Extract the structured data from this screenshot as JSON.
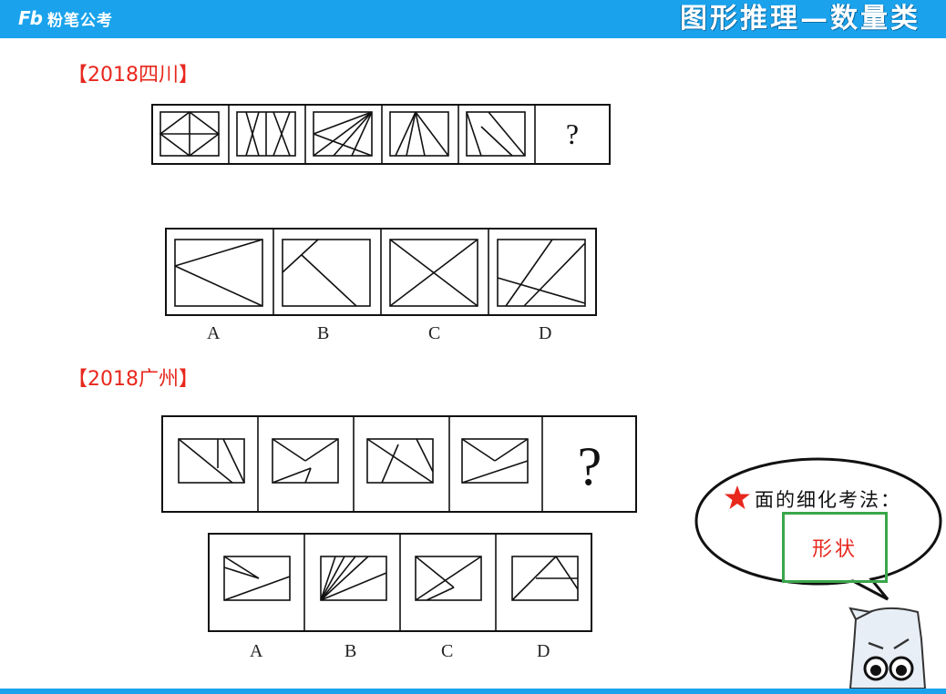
{
  "header": {
    "logo_mark": "Fb",
    "logo_text": "粉笔公考",
    "title": "图形推理—数量类"
  },
  "question1": {
    "label": "【2018四川】",
    "question_mark": "?",
    "options": [
      "A",
      "B",
      "C",
      "D"
    ]
  },
  "question2": {
    "label": "【2018广州】",
    "question_mark": "?",
    "options": [
      "A",
      "B",
      "C",
      "D"
    ]
  },
  "bubble": {
    "title": "面的细化考法：",
    "answer": "形状"
  },
  "icons": {
    "star": "star-icon",
    "mascot": "mascot-character"
  },
  "colors": {
    "header_bar": "#1aa3ec",
    "label_red": "#e8271d",
    "answer_border": "#3aa64a"
  }
}
